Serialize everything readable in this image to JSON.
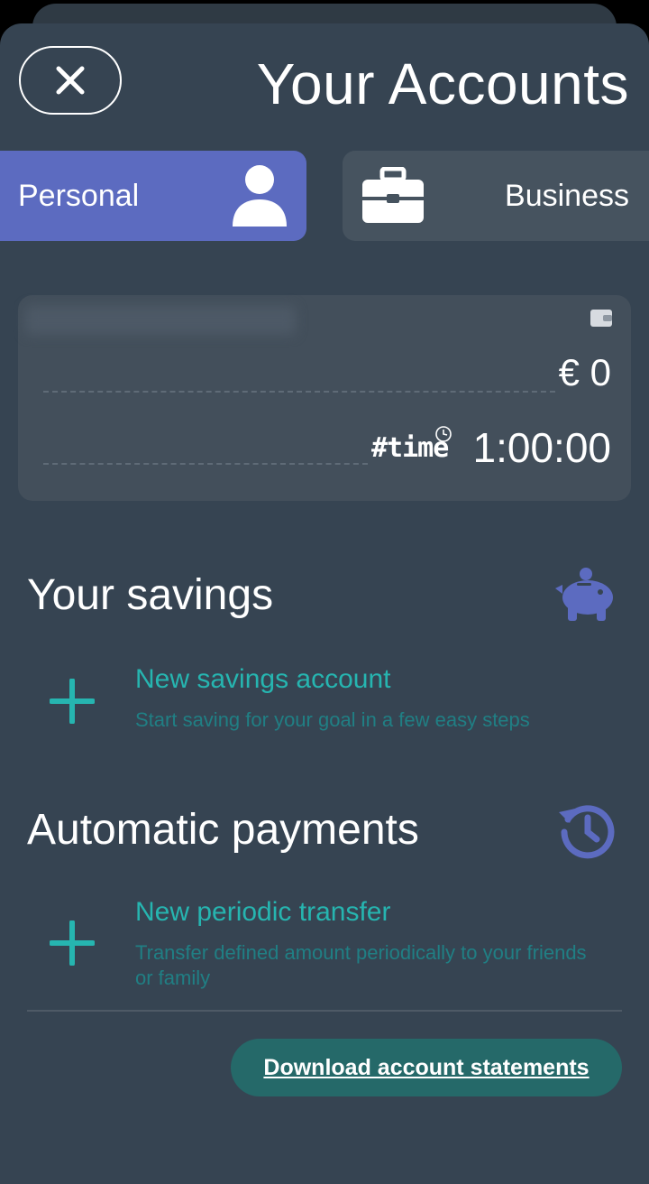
{
  "header": {
    "title": "Your Accounts",
    "close_icon": "close-icon"
  },
  "tabs": [
    {
      "label": "Personal",
      "icon": "person-icon",
      "selected": true
    },
    {
      "label": "Business",
      "icon": "briefcase-icon",
      "selected": false
    }
  ],
  "account_card": {
    "icon": "wallet-icon",
    "balance": "€ 0",
    "time_label": "#time",
    "time_icon": "clock-icon",
    "time_value": "1:00:00"
  },
  "savings": {
    "title": "Your savings",
    "icon": "piggy-bank-icon",
    "item": {
      "icon": "plus-icon",
      "title": "New savings account",
      "subtitle": "Start saving for your goal in a few easy steps"
    }
  },
  "payments": {
    "title": "Automatic payments",
    "icon": "history-icon",
    "item": {
      "icon": "plus-icon",
      "title": "New periodic transfer",
      "subtitle": "Transfer defined amount periodically to your friends or family"
    }
  },
  "footer": {
    "download_label": "Download account statements"
  },
  "colors": {
    "background": "#364452",
    "accent_purple": "#5c6bc0",
    "accent_teal": "#26b5b0",
    "button_teal": "#256969"
  }
}
